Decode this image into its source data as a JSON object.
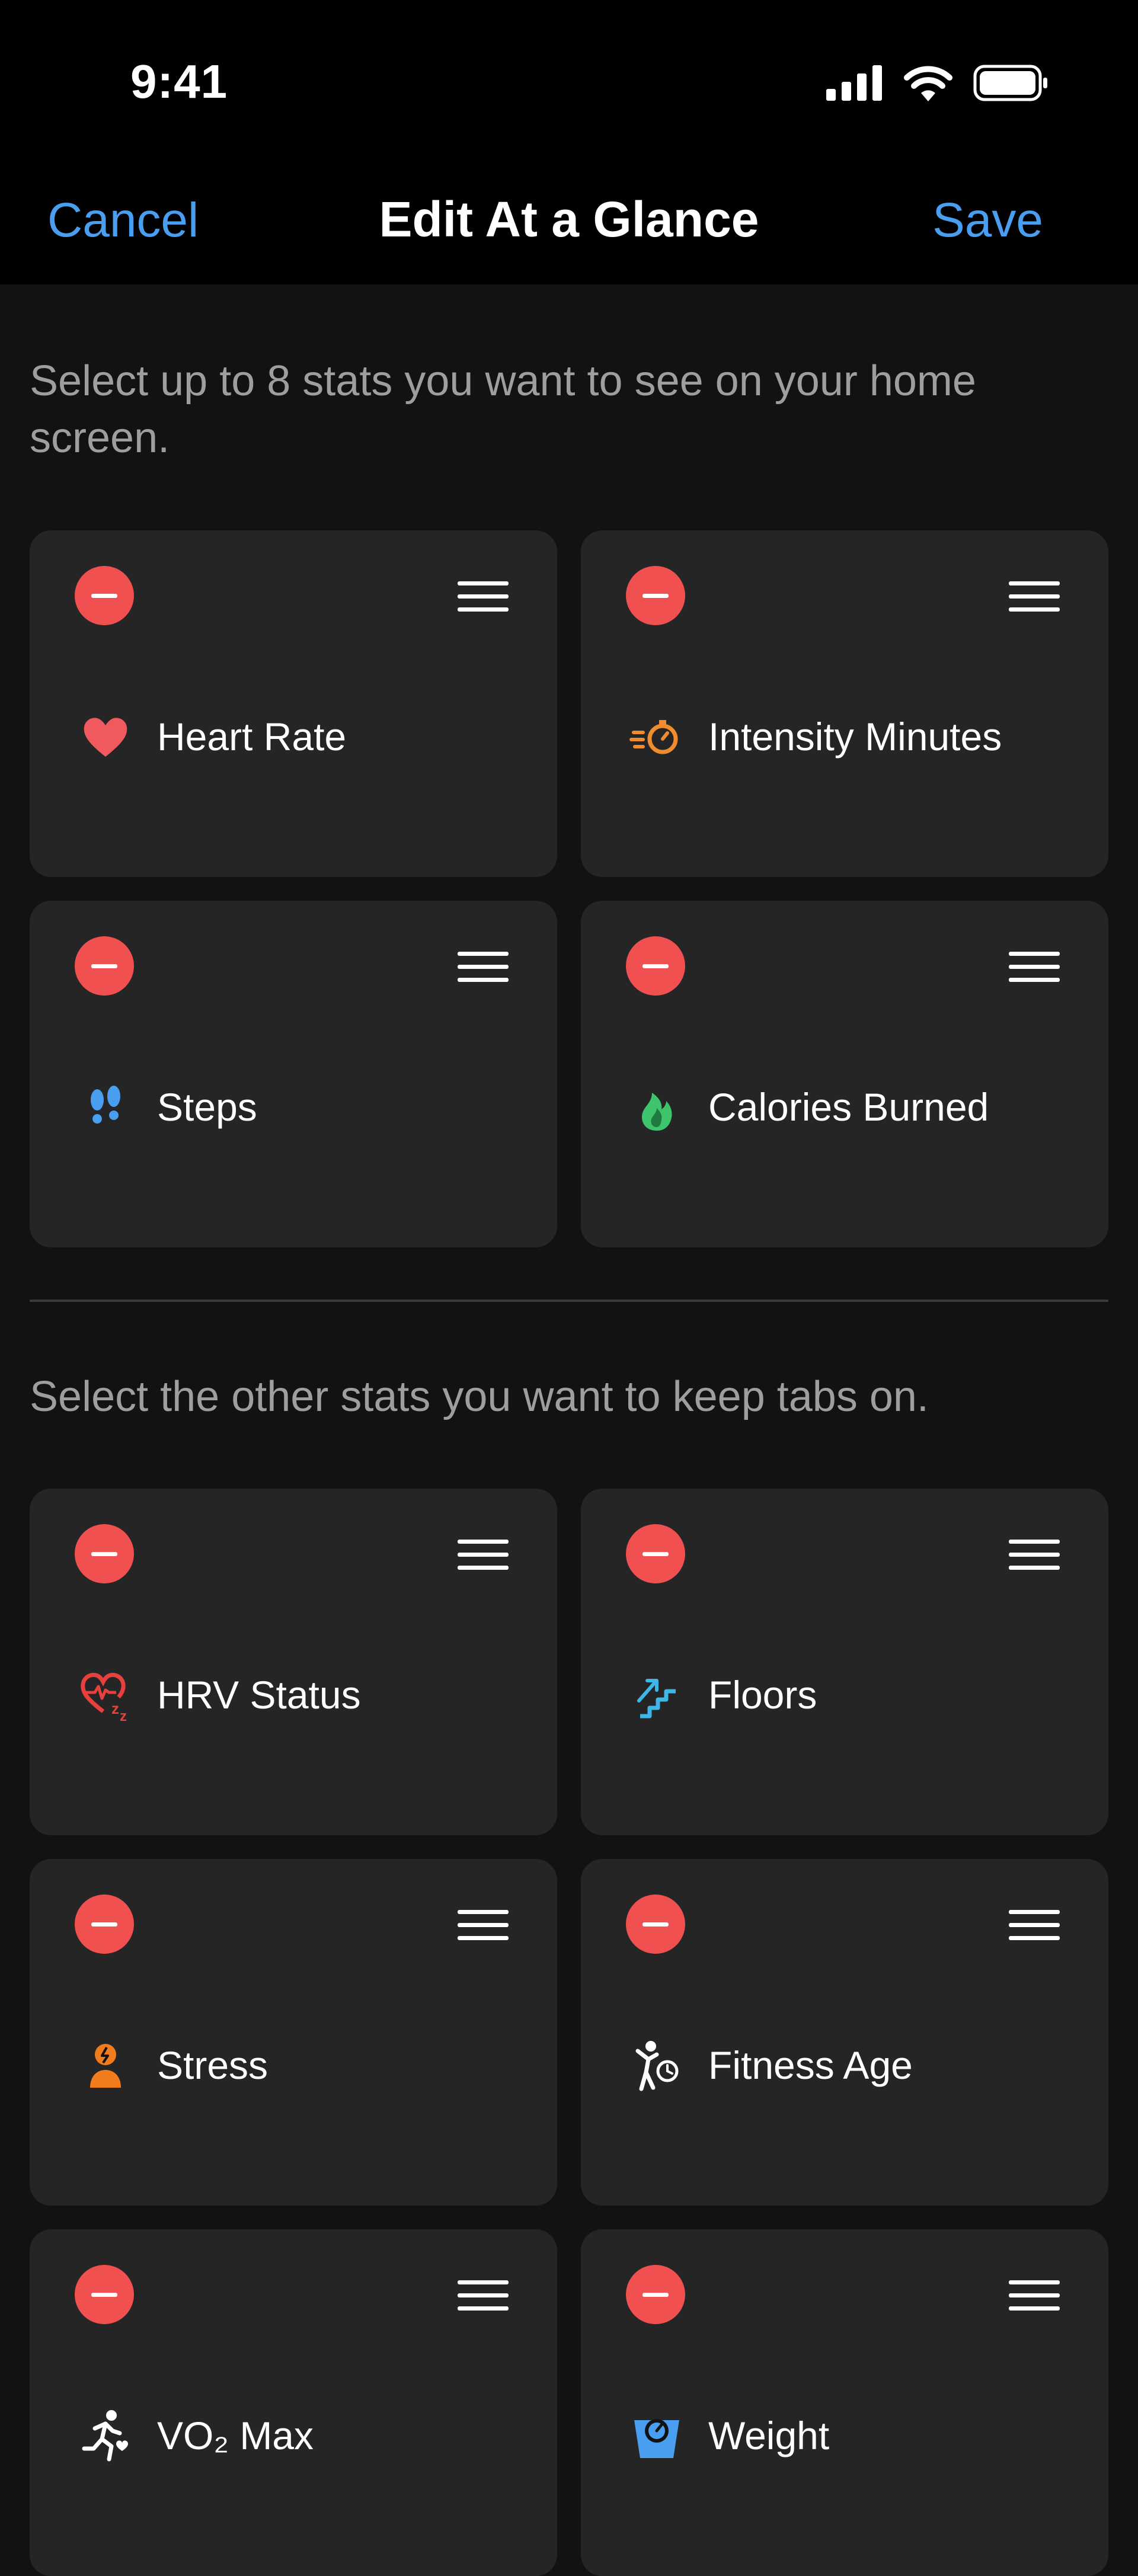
{
  "status_bar": {
    "time": "9:41"
  },
  "nav": {
    "cancel": "Cancel",
    "title": "Edit At a Glance",
    "save": "Save"
  },
  "instructions": {
    "top": "Select up to 8 stats you want to see on your home screen.",
    "other": "Select the other stats you want to keep tabs on."
  },
  "glance_stats": [
    {
      "label": "Heart Rate",
      "icon": "heart-icon",
      "color": "#f05a5e"
    },
    {
      "label": "Intensity Minutes",
      "icon": "intensity-stopwatch-icon",
      "color": "#f08c2e"
    },
    {
      "label": "Steps",
      "icon": "footprints-icon",
      "color": "#4a9ef0"
    },
    {
      "label": "Calories Burned",
      "icon": "flame-icon",
      "color": "#3ec46d"
    }
  ],
  "other_stats": [
    {
      "label": "HRV Status",
      "icon": "hrv-heart-icon",
      "color": "#e8403c"
    },
    {
      "label": "Floors",
      "icon": "stairs-icon",
      "color": "#3fb6e8"
    },
    {
      "label": "Stress",
      "icon": "stress-person-icon",
      "color": "#f07c1e"
    },
    {
      "label": "Fitness Age",
      "icon": "fitness-age-icon",
      "color": "#ffffff"
    },
    {
      "label": "VO₂ Max",
      "icon": "runner-icon",
      "color": "#ffffff"
    },
    {
      "label": "Weight",
      "icon": "scale-icon",
      "color": "#4a9ef0"
    }
  ]
}
